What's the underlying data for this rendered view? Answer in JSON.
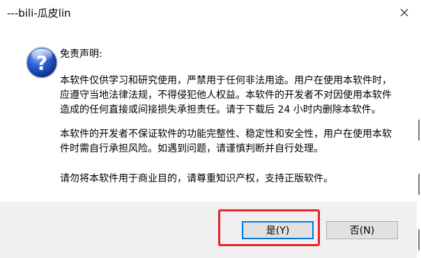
{
  "window": {
    "title": "---bili-瓜皮lin"
  },
  "titlebar": {
    "close_icon": "close-icon"
  },
  "dialog": {
    "icon": "question-icon",
    "heading": "免责声明:",
    "para1_line1": "本软件仅供学习和研究使用，严禁用于任何非法用途。用户在使用本软件时，",
    "para1_line2": "应遵守当地法律法规，不得侵犯他人权益。本软件的开发者不对因使用本软件",
    "para1_line3": "造成的任何直接或间接损失承担责任。请于下载后 24 小时内删除本软件。",
    "para2_line1": "本软件的开发者不保证软件的功能完整性、稳定性和安全性，用户在使用本软",
    "para2_line2": "件时需自行承担风险。如遇到问题，请谨慎判断并自行处理。",
    "para3_line1": "请勿将本软件用于商业目的，请尊重知识产权，支持正版软件。"
  },
  "buttons": {
    "yes_label": "是(Y)",
    "no_label": "否(N)"
  },
  "colors": {
    "highlight": "#e5232a",
    "footer_bg": "#f0f0f0",
    "focus_border": "#0078d7"
  }
}
